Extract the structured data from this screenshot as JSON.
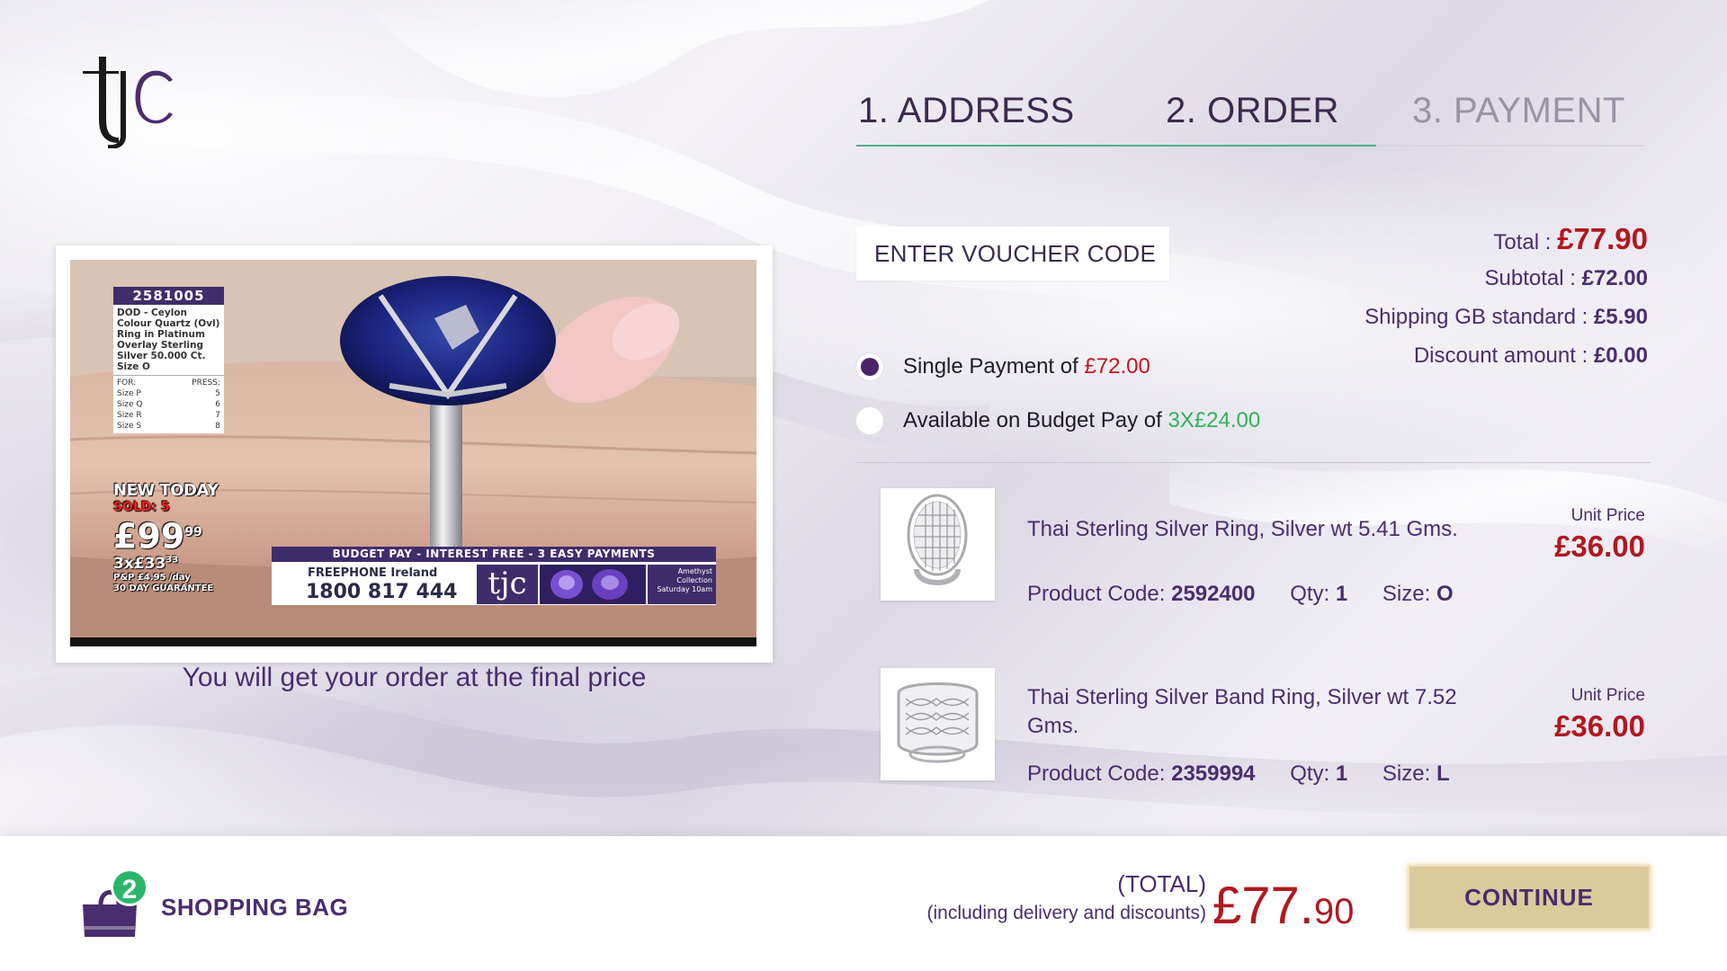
{
  "brand": {
    "logo_text": "tjc"
  },
  "steps": [
    {
      "label": "1. ADDRESS",
      "state": "done"
    },
    {
      "label": "2. ORDER",
      "state": "active"
    },
    {
      "label": "3. PAYMENT",
      "state": "upcoming"
    }
  ],
  "video": {
    "product_code": "2581005",
    "description": "DOD - Ceylon Colour Quartz (Ovl) Ring in Platinum Overlay Sterling Silver 50.000 Ct. Size O",
    "sizes_header": {
      "for": "FOR:",
      "press": "PRESS:"
    },
    "sizes": [
      {
        "size": "Size P",
        "press": "5"
      },
      {
        "size": "Size Q",
        "press": "6"
      },
      {
        "size": "Size R",
        "press": "7"
      },
      {
        "size": "Size S",
        "press": "8"
      }
    ],
    "new_today": "NEW TODAY",
    "sold": "SOLD: 5",
    "price_main": "£99",
    "price_pence": "99",
    "budget_main": "3x£33",
    "budget_pence": "33",
    "pp_line": "P&P £4.95 /day",
    "guarantee": "30 DAY GUARANTEE",
    "banner_title": "BUDGET PAY - INTEREST FREE - 3 EASY PAYMENTS",
    "phone_label": "FREEPHONE Ireland",
    "phone_number": "1800 817 444",
    "banner_logo": "tjc",
    "gem_caption": "Amethyst Collection Saturday 10am"
  },
  "note": "You will get your order at the final price",
  "voucher": {
    "placeholder": "ENTER VOUCHER CODE"
  },
  "totals": {
    "total_label": "Total :",
    "total_value": "£77.90",
    "subtotal_label": "Subtotal :",
    "subtotal_value": "£72.00",
    "shipping_label": "Shipping GB standard :",
    "shipping_value": "£5.90",
    "discount_label": "Discount amount :",
    "discount_value": "£0.00"
  },
  "payment_options": [
    {
      "text": "Single Payment of ",
      "amount": "£72.00",
      "selected": true
    },
    {
      "text": "Available on Budget Pay of ",
      "amount": "3X£24.00",
      "selected": false
    }
  ],
  "products": [
    {
      "name": "Thai Sterling Silver Ring, Silver wt 5.41 Gms.",
      "code_label": "Product Code:",
      "code": "2592400",
      "qty_label": "Qty:",
      "qty": "1",
      "size_label": "Size:",
      "size": "O",
      "unit_label": "Unit Price",
      "unit_price": "£36.00"
    },
    {
      "name": "Thai Sterling Silver Band Ring, Silver wt 7.52 Gms.",
      "code_label": "Product Code:",
      "code": "2359994",
      "qty_label": "Qty:",
      "qty": "1",
      "size_label": "Size:",
      "size": "L",
      "unit_label": "Unit Price",
      "unit_price": "£36.00"
    }
  ],
  "bottom": {
    "bag_count": "2",
    "bag_label": "SHOPPING BAG",
    "total_label": "(TOTAL)",
    "total_sub_label": "(including delivery and discounts)",
    "total_big": "£77.",
    "total_small": "90",
    "continue_label": "CONTINUE"
  },
  "colors": {
    "brand_purple": "#4a2d6e",
    "price_red": "#b01820",
    "accent_green": "#2bb56a",
    "continue_gold": "#dcc99c"
  }
}
